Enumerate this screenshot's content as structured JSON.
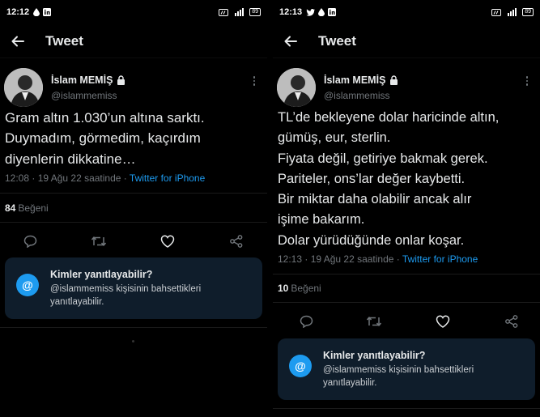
{
  "screens": [
    {
      "status": {
        "time": "12:12",
        "icons_left": [
          "water-drop-icon",
          "linkedin-icon"
        ],
        "battery": "89"
      },
      "header": {
        "title": "Tweet"
      },
      "author": {
        "name": "İslam MEMİŞ",
        "handle": "@islammemiss",
        "protected": true
      },
      "tweet": {
        "lines": [
          "Gram altın 1.030’un altına sarktı.",
          "Duymadım, görmedim, kaçırdım",
          "diyenlerin dikkatine…"
        ],
        "time": "12:08 · 19 Ağu 22 saatinde · ",
        "source": "Twitter for iPhone"
      },
      "likes": {
        "count": "84",
        "label": "Beğeni"
      },
      "actions": [
        "reply-icon",
        "retweet-icon",
        "like-icon",
        "share-icon"
      ],
      "reply_card": {
        "title": "Kimler yanıtlayabilir?",
        "description": "@islammemiss kişisinin bahsettikleri yanıtlayabilir.",
        "icon": "@"
      }
    },
    {
      "status": {
        "time": "12:13",
        "icons_left": [
          "twitter-icon",
          "water-drop-icon",
          "linkedin-icon"
        ],
        "battery": "89"
      },
      "header": {
        "title": "Tweet"
      },
      "author": {
        "name": "İslam MEMİŞ",
        "handle": "@islammemiss",
        "protected": true
      },
      "tweet": {
        "lines": [
          "TL’de bekleyene dolar haricinde altın,",
          "gümüş, eur, sterlin.",
          "Fiyata değil, getiriye bakmak gerek.",
          "Pariteler, ons’lar değer kaybetti.",
          "Bir miktar daha olabilir ancak alır",
          "işime bakarım.",
          "Dolar yürüdüğünde onlar koşar."
        ],
        "time": "12:13 · 19 Ağu 22 saatinde · ",
        "source": "Twitter for iPhone"
      },
      "likes": {
        "count": "10",
        "label": "Beğeni"
      },
      "actions": [
        "reply-icon",
        "retweet-icon",
        "like-icon",
        "share-icon"
      ],
      "reply_card": {
        "title": "Kimler yanıtlayabilir?",
        "description": "@islammemiss kişisinin bahsettikleri yanıtlayabilir.",
        "icon": "@"
      }
    }
  ],
  "colors": {
    "background": "#000000",
    "text": "#e7e9ea",
    "muted": "#71767b",
    "accent": "#1d9bf0",
    "card": "#0f1d2b"
  }
}
